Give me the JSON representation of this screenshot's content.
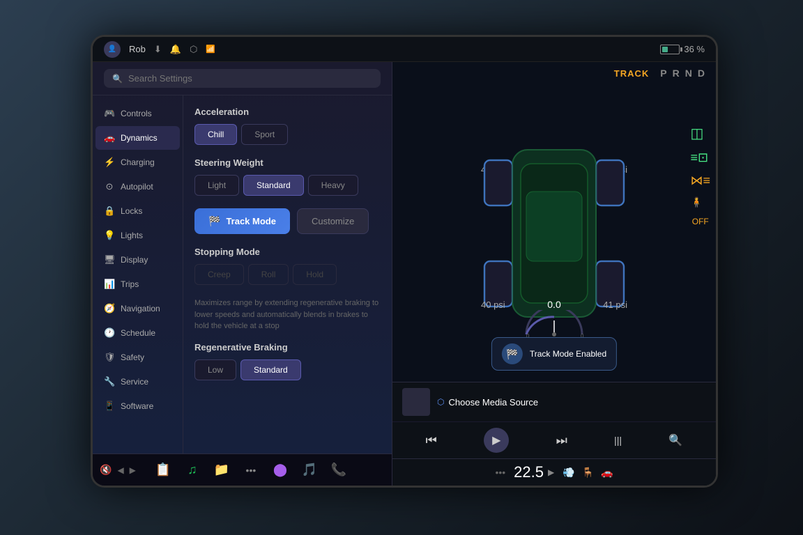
{
  "screen": {
    "status_bar": {
      "username": "Rob",
      "battery_percent": "36 %",
      "gear": {
        "track": "TRACK",
        "p": "P",
        "r": "R",
        "n": "N",
        "d": "D"
      }
    },
    "search": {
      "placeholder": "Search Settings"
    },
    "sidebar": {
      "items": [
        {
          "id": "controls",
          "label": "Controls",
          "icon": "🎮"
        },
        {
          "id": "dynamics",
          "label": "Dynamics",
          "icon": "🚗",
          "active": true
        },
        {
          "id": "charging",
          "label": "Charging",
          "icon": "⚡"
        },
        {
          "id": "autopilot",
          "label": "Autopilot",
          "icon": "⊙"
        },
        {
          "id": "locks",
          "label": "Locks",
          "icon": "🔒"
        },
        {
          "id": "lights",
          "label": "Lights",
          "icon": "💡"
        },
        {
          "id": "display",
          "label": "Display",
          "icon": "🖥"
        },
        {
          "id": "trips",
          "label": "Trips",
          "icon": "📊"
        },
        {
          "id": "navigation",
          "label": "Navigation",
          "icon": "🧭"
        },
        {
          "id": "schedule",
          "label": "Schedule",
          "icon": "🕐"
        },
        {
          "id": "safety",
          "label": "Safety",
          "icon": "🛡"
        },
        {
          "id": "service",
          "label": "Service",
          "icon": "🔧"
        },
        {
          "id": "software",
          "label": "Software",
          "icon": "📱"
        }
      ]
    },
    "dynamics": {
      "acceleration": {
        "title": "Acceleration",
        "options": [
          "Chill",
          "Sport"
        ],
        "active": "Chill"
      },
      "steering_weight": {
        "title": "Steering Weight",
        "options": [
          "Light",
          "Standard",
          "Heavy"
        ],
        "active": "Standard"
      },
      "track_mode_label": "Track Mode",
      "customize_label": "Customize",
      "stopping_mode": {
        "title": "Stopping Mode",
        "options": [
          "Creep",
          "Roll",
          "Hold"
        ],
        "active": "Hold"
      },
      "stopping_info": "Maximizes range by extending regenerative braking to lower speeds and automatically blends in brakes to hold the vehicle at a stop",
      "regen_braking": {
        "title": "Regenerative Braking",
        "options": [
          "Low",
          "Standard"
        ],
        "active": "Standard"
      }
    },
    "vehicle": {
      "tires": {
        "fl": "40 psi",
        "fr": "40 psi",
        "rl": "40 psi",
        "rr": "41 psi"
      },
      "speed": "0.0",
      "track_notification": "Track Mode Enabled"
    },
    "media": {
      "source": "Choose Media Source",
      "bluetooth_icon": "⬡"
    },
    "climate": {
      "temperature": "22.5"
    },
    "taskbar": {
      "apps": [
        "📋",
        "🎵",
        "📁",
        "•••",
        "🔮",
        "🎵",
        "📞"
      ]
    }
  }
}
